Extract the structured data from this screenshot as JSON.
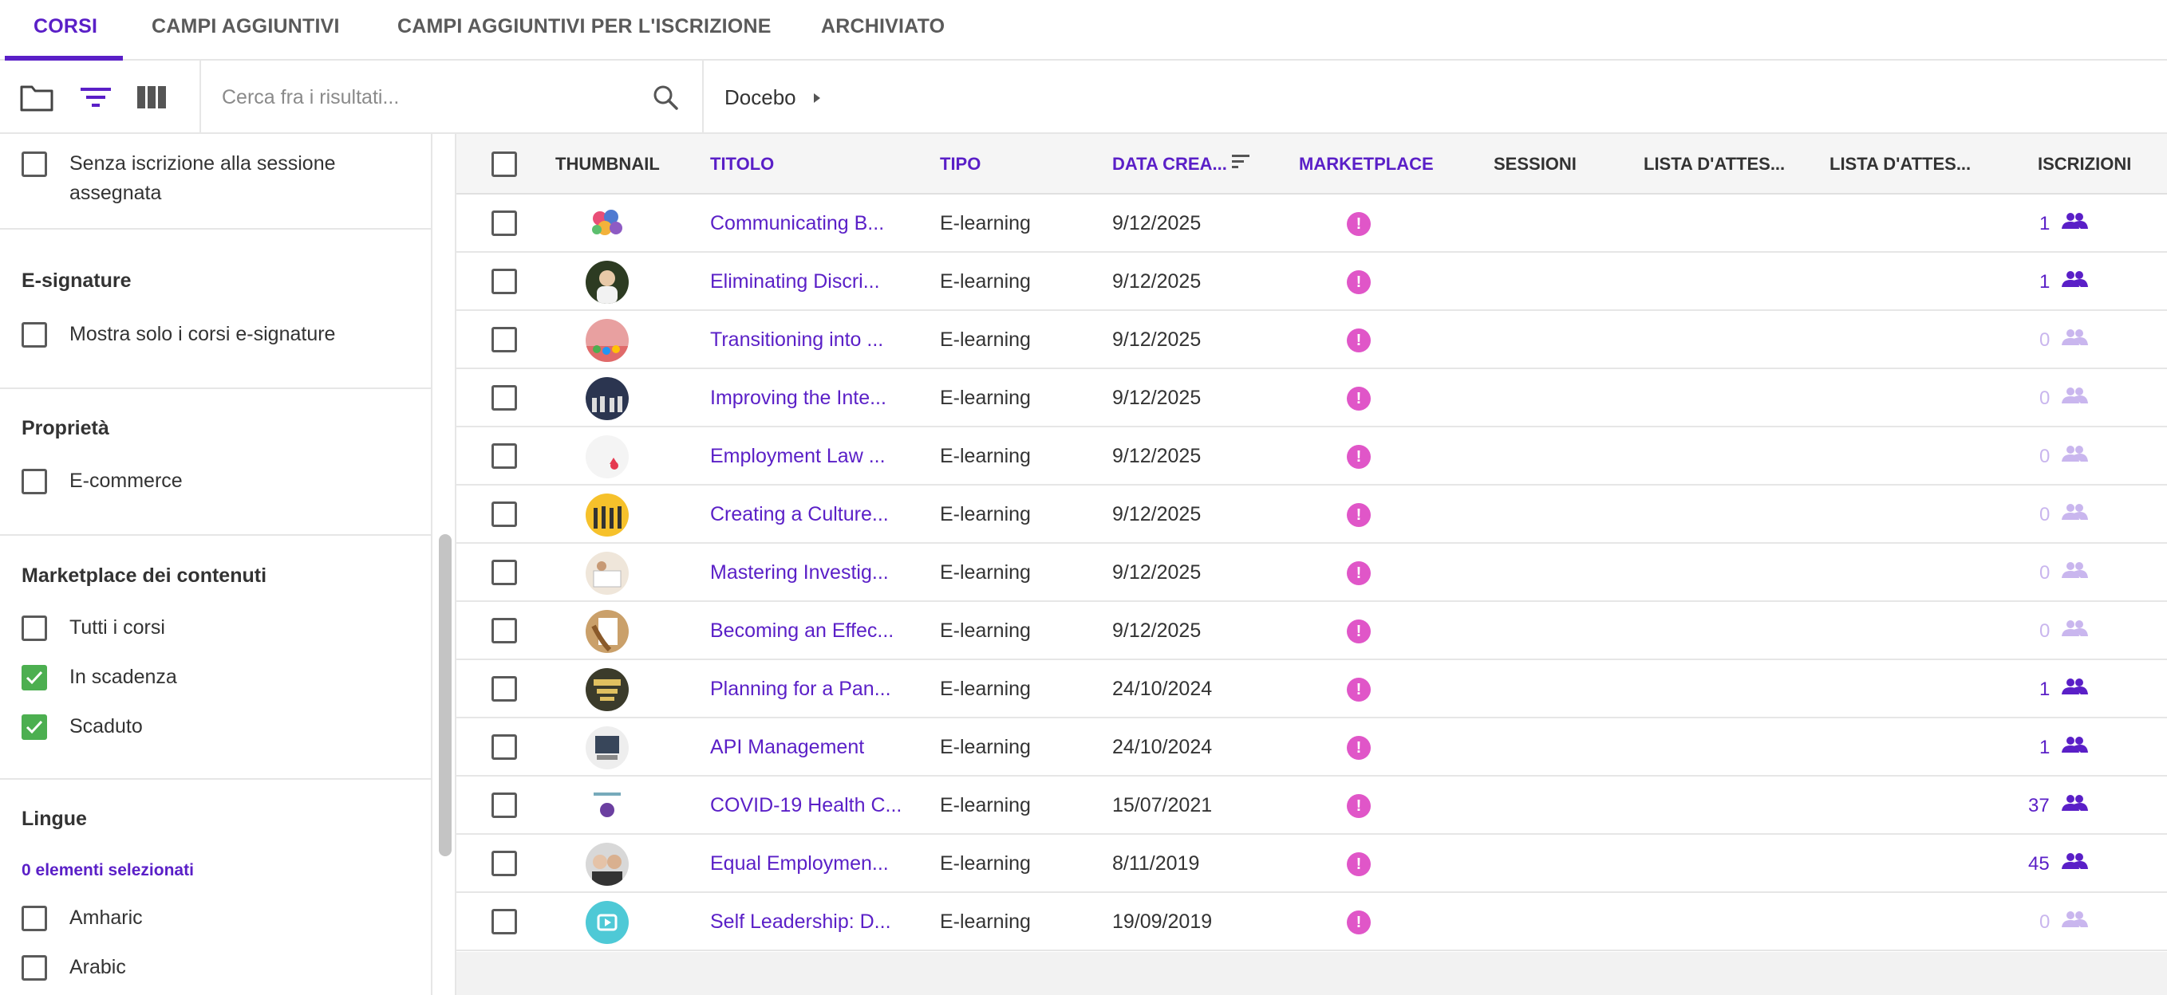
{
  "tabs": [
    {
      "label": "CORSI"
    },
    {
      "label": "CAMPI AGGIUNTIVI"
    },
    {
      "label": "CAMPI AGGIUNTIVI PER L'ISCRIZIONE"
    },
    {
      "label": "ARCHIVIATO"
    }
  ],
  "toolbar": {
    "search_placeholder": "Cerca fra i risultati...",
    "breadcrumb": "Docebo"
  },
  "sidebar": {
    "session": {
      "label": "Senza iscrizione alla sessione assegnata",
      "checked": false
    },
    "esignature": {
      "title": "E-signature",
      "option": "Mostra solo i corsi e-signature"
    },
    "properties": {
      "title": "Proprietà",
      "option": "E-commerce"
    },
    "marketplace": {
      "title": "Marketplace dei contenuti",
      "options": [
        {
          "label": "Tutti i corsi",
          "checked": false
        },
        {
          "label": "In scadenza",
          "checked": true
        },
        {
          "label": "Scaduto",
          "checked": true
        }
      ]
    },
    "languages": {
      "title": "Lingue",
      "selected": "0 elementi selezionati",
      "options": [
        {
          "label": "Amharic"
        },
        {
          "label": "Arabic"
        }
      ]
    }
  },
  "table": {
    "headers": {
      "thumbnail": "THUMBNAIL",
      "title": "TITOLO",
      "type": "TIPO",
      "created": "DATA CREA...",
      "marketplace": "MARKETPLACE",
      "sessions": "SESSIONI",
      "waitlist1": "LISTA D'ATTES...",
      "waitlist2": "LISTA D'ATTES...",
      "enrollments": "ISCRIZIONI"
    },
    "rows": [
      {
        "title": "Communicating B...",
        "type": "E-learning",
        "date": "9/12/2025",
        "enrollments": "1"
      },
      {
        "title": "Eliminating Discri...",
        "type": "E-learning",
        "date": "9/12/2025",
        "enrollments": "1"
      },
      {
        "title": "Transitioning into ...",
        "type": "E-learning",
        "date": "9/12/2025",
        "enrollments": "0"
      },
      {
        "title": "Improving the Inte...",
        "type": "E-learning",
        "date": "9/12/2025",
        "enrollments": "0"
      },
      {
        "title": "Employment Law ...",
        "type": "E-learning",
        "date": "9/12/2025",
        "enrollments": "0"
      },
      {
        "title": "Creating a Culture...",
        "type": "E-learning",
        "date": "9/12/2025",
        "enrollments": "0"
      },
      {
        "title": "Mastering Investig...",
        "type": "E-learning",
        "date": "9/12/2025",
        "enrollments": "0"
      },
      {
        "title": "Becoming an Effec...",
        "type": "E-learning",
        "date": "9/12/2025",
        "enrollments": "0"
      },
      {
        "title": "Planning for a Pan...",
        "type": "E-learning",
        "date": "24/10/2024",
        "enrollments": "1"
      },
      {
        "title": "API Management",
        "type": "E-learning",
        "date": "24/10/2024",
        "enrollments": "1"
      },
      {
        "title": "COVID-19 Health C...",
        "type": "E-learning",
        "date": "15/07/2021",
        "enrollments": "37"
      },
      {
        "title": "Equal Employmen...",
        "type": "E-learning",
        "date": "8/11/2019",
        "enrollments": "45"
      },
      {
        "title": "Self Leadership: D...",
        "type": "E-learning",
        "date": "19/09/2019",
        "enrollments": "0"
      }
    ]
  },
  "colors": {
    "accent": "#5a1fc7",
    "check_green": "#4caf50",
    "marketplace_dot": "#e056c8"
  }
}
